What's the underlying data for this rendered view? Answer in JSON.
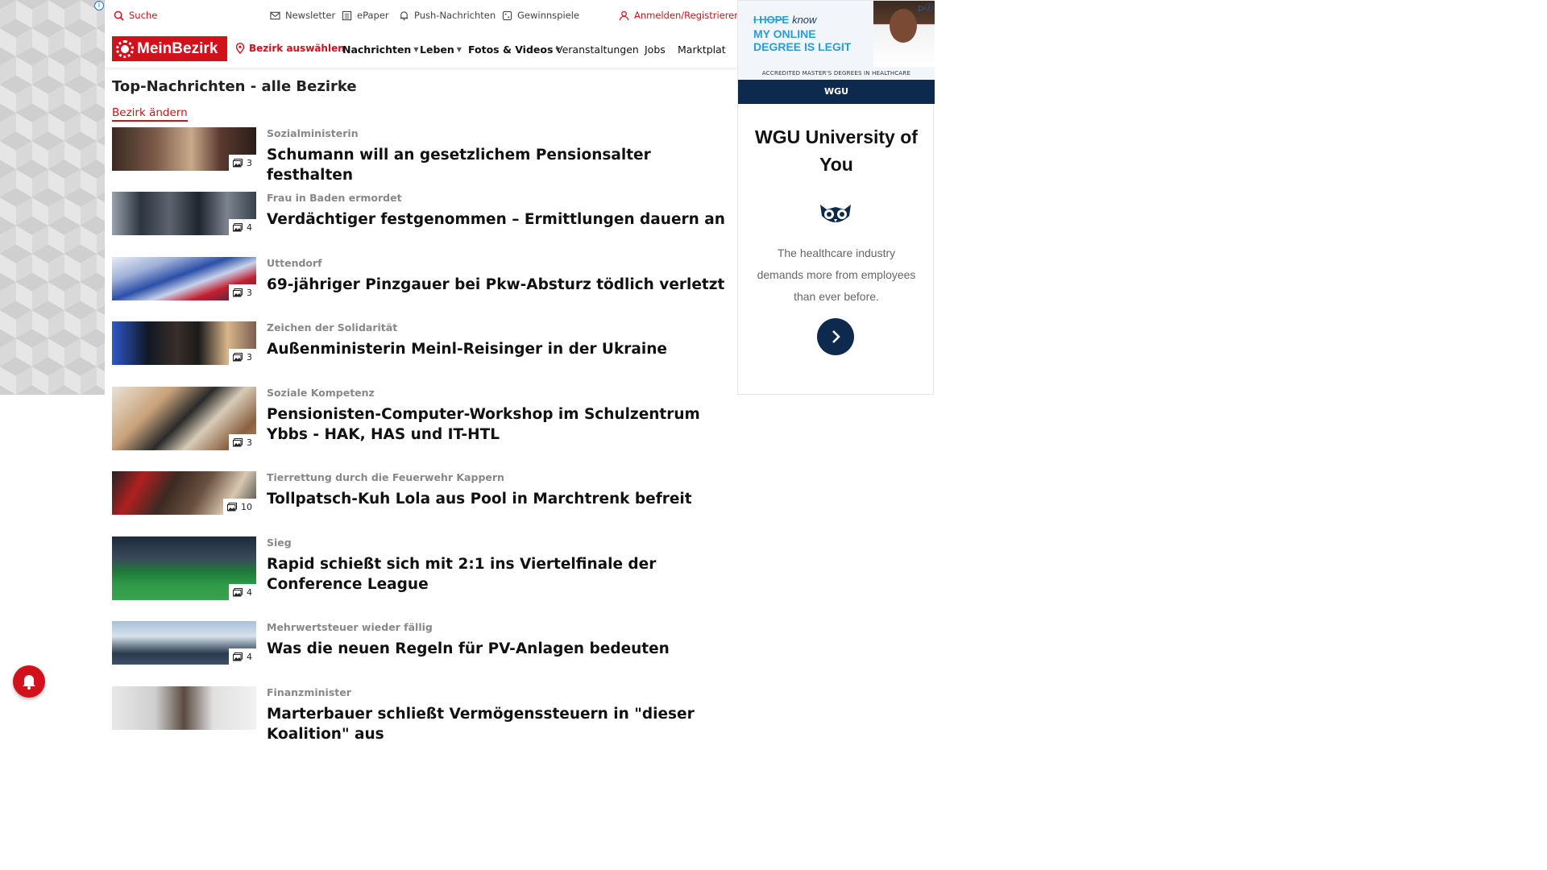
{
  "utility": {
    "search": "Suche",
    "newsletter": "Newsletter",
    "epaper": "ePaper",
    "push": "Push-Nachrichten",
    "gewinnspiele": "Gewinnspiele",
    "login": "Anmelden/Registrieren"
  },
  "nav": {
    "logo": "MeinBezirk",
    "bezirk": "Bezirk auswählen",
    "items": [
      "Nachrichten",
      "Leben",
      "Fotos & Videos",
      "Veranstaltungen",
      "Jobs",
      "Marktplatz"
    ]
  },
  "main": {
    "title": "Top-Nachrichten - alle Bezirke",
    "change_link": "Bezirk ändern"
  },
  "articles": [
    {
      "kicker": "Sozialministerin",
      "headline": "Schumann will an gesetzlichem Pensionsalter festhalten",
      "count": "3"
    },
    {
      "kicker": "Frau in Baden ermordet",
      "headline": "Verdächtiger festgenommen – Ermittlungen dauern an",
      "count": "4"
    },
    {
      "kicker": "Uttendorf",
      "headline": "69-jähriger Pinzgauer bei Pkw-Absturz tödlich verletzt",
      "count": "3"
    },
    {
      "kicker": "Zeichen der Solidarität",
      "headline": "Außenministerin Meinl-Reisinger in der Ukraine",
      "count": "3"
    },
    {
      "kicker": "Soziale Kompetenz",
      "headline": "Pensionisten-Computer-Workshop im Schulzentrum Ybbs - HAK, HAS und IT-HTL",
      "count": "3"
    },
    {
      "kicker": "Tierrettung durch die Feuerwehr Kappern",
      "headline": "Tollpatsch-Kuh Lola aus Pool in Marchtrenk befreit",
      "count": "10"
    },
    {
      "kicker": "Sieg",
      "headline": "Rapid schießt sich mit 2:1 ins Viertelfinale der Conference League",
      "count": "4"
    },
    {
      "kicker": "Mehrwertsteuer wieder fällig",
      "headline": "Was die neuen Regeln für PV-Anlagen bedeuten",
      "count": "4"
    },
    {
      "kicker": "Finanzminister",
      "headline": "Marterbauer schließt Vermögenssteuern in \"dieser Koalition\" aus",
      "count": ""
    }
  ],
  "ad": {
    "head_hope": "I HOPE",
    "head_know": "know",
    "head_line2": "MY ONLINE",
    "head_line3": "DEGREE IS LEGIT",
    "accred": "ACCREDITED MASTER'S DEGREES IN HEALTHCARE",
    "strip": "WGU",
    "title": "WGU University of You",
    "text": "The healthcare industry demands more from employees than ever before."
  },
  "colors": {
    "accent": "#d1111c",
    "ad_navy": "#0d2a4e"
  }
}
